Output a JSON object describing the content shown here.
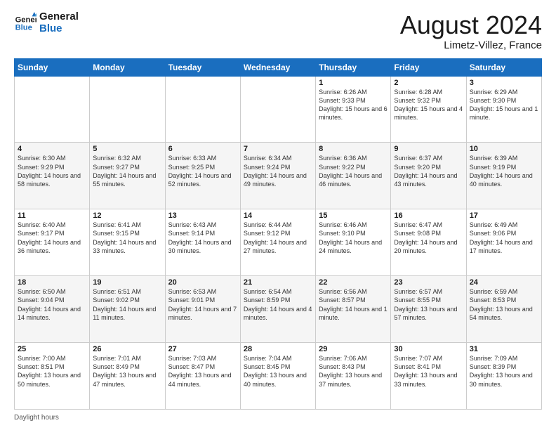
{
  "logo": {
    "line1": "General",
    "line2": "Blue"
  },
  "title": "August 2024",
  "location": "Limetz-Villez, France",
  "days_of_week": [
    "Sunday",
    "Monday",
    "Tuesday",
    "Wednesday",
    "Thursday",
    "Friday",
    "Saturday"
  ],
  "footer_label": "Daylight hours",
  "weeks": [
    [
      {
        "day": "",
        "info": ""
      },
      {
        "day": "",
        "info": ""
      },
      {
        "day": "",
        "info": ""
      },
      {
        "day": "",
        "info": ""
      },
      {
        "day": "1",
        "info": "Sunrise: 6:26 AM\nSunset: 9:33 PM\nDaylight: 15 hours\nand 6 minutes."
      },
      {
        "day": "2",
        "info": "Sunrise: 6:28 AM\nSunset: 9:32 PM\nDaylight: 15 hours\nand 4 minutes."
      },
      {
        "day": "3",
        "info": "Sunrise: 6:29 AM\nSunset: 9:30 PM\nDaylight: 15 hours\nand 1 minute."
      }
    ],
    [
      {
        "day": "4",
        "info": "Sunrise: 6:30 AM\nSunset: 9:29 PM\nDaylight: 14 hours\nand 58 minutes."
      },
      {
        "day": "5",
        "info": "Sunrise: 6:32 AM\nSunset: 9:27 PM\nDaylight: 14 hours\nand 55 minutes."
      },
      {
        "day": "6",
        "info": "Sunrise: 6:33 AM\nSunset: 9:25 PM\nDaylight: 14 hours\nand 52 minutes."
      },
      {
        "day": "7",
        "info": "Sunrise: 6:34 AM\nSunset: 9:24 PM\nDaylight: 14 hours\nand 49 minutes."
      },
      {
        "day": "8",
        "info": "Sunrise: 6:36 AM\nSunset: 9:22 PM\nDaylight: 14 hours\nand 46 minutes."
      },
      {
        "day": "9",
        "info": "Sunrise: 6:37 AM\nSunset: 9:20 PM\nDaylight: 14 hours\nand 43 minutes."
      },
      {
        "day": "10",
        "info": "Sunrise: 6:39 AM\nSunset: 9:19 PM\nDaylight: 14 hours\nand 40 minutes."
      }
    ],
    [
      {
        "day": "11",
        "info": "Sunrise: 6:40 AM\nSunset: 9:17 PM\nDaylight: 14 hours\nand 36 minutes."
      },
      {
        "day": "12",
        "info": "Sunrise: 6:41 AM\nSunset: 9:15 PM\nDaylight: 14 hours\nand 33 minutes."
      },
      {
        "day": "13",
        "info": "Sunrise: 6:43 AM\nSunset: 9:14 PM\nDaylight: 14 hours\nand 30 minutes."
      },
      {
        "day": "14",
        "info": "Sunrise: 6:44 AM\nSunset: 9:12 PM\nDaylight: 14 hours\nand 27 minutes."
      },
      {
        "day": "15",
        "info": "Sunrise: 6:46 AM\nSunset: 9:10 PM\nDaylight: 14 hours\nand 24 minutes."
      },
      {
        "day": "16",
        "info": "Sunrise: 6:47 AM\nSunset: 9:08 PM\nDaylight: 14 hours\nand 20 minutes."
      },
      {
        "day": "17",
        "info": "Sunrise: 6:49 AM\nSunset: 9:06 PM\nDaylight: 14 hours\nand 17 minutes."
      }
    ],
    [
      {
        "day": "18",
        "info": "Sunrise: 6:50 AM\nSunset: 9:04 PM\nDaylight: 14 hours\nand 14 minutes."
      },
      {
        "day": "19",
        "info": "Sunrise: 6:51 AM\nSunset: 9:02 PM\nDaylight: 14 hours\nand 11 minutes."
      },
      {
        "day": "20",
        "info": "Sunrise: 6:53 AM\nSunset: 9:01 PM\nDaylight: 14 hours\nand 7 minutes."
      },
      {
        "day": "21",
        "info": "Sunrise: 6:54 AM\nSunset: 8:59 PM\nDaylight: 14 hours\nand 4 minutes."
      },
      {
        "day": "22",
        "info": "Sunrise: 6:56 AM\nSunset: 8:57 PM\nDaylight: 14 hours\nand 1 minute."
      },
      {
        "day": "23",
        "info": "Sunrise: 6:57 AM\nSunset: 8:55 PM\nDaylight: 13 hours\nand 57 minutes."
      },
      {
        "day": "24",
        "info": "Sunrise: 6:59 AM\nSunset: 8:53 PM\nDaylight: 13 hours\nand 54 minutes."
      }
    ],
    [
      {
        "day": "25",
        "info": "Sunrise: 7:00 AM\nSunset: 8:51 PM\nDaylight: 13 hours\nand 50 minutes."
      },
      {
        "day": "26",
        "info": "Sunrise: 7:01 AM\nSunset: 8:49 PM\nDaylight: 13 hours\nand 47 minutes."
      },
      {
        "day": "27",
        "info": "Sunrise: 7:03 AM\nSunset: 8:47 PM\nDaylight: 13 hours\nand 44 minutes."
      },
      {
        "day": "28",
        "info": "Sunrise: 7:04 AM\nSunset: 8:45 PM\nDaylight: 13 hours\nand 40 minutes."
      },
      {
        "day": "29",
        "info": "Sunrise: 7:06 AM\nSunset: 8:43 PM\nDaylight: 13 hours\nand 37 minutes."
      },
      {
        "day": "30",
        "info": "Sunrise: 7:07 AM\nSunset: 8:41 PM\nDaylight: 13 hours\nand 33 minutes."
      },
      {
        "day": "31",
        "info": "Sunrise: 7:09 AM\nSunset: 8:39 PM\nDaylight: 13 hours\nand 30 minutes."
      }
    ]
  ]
}
